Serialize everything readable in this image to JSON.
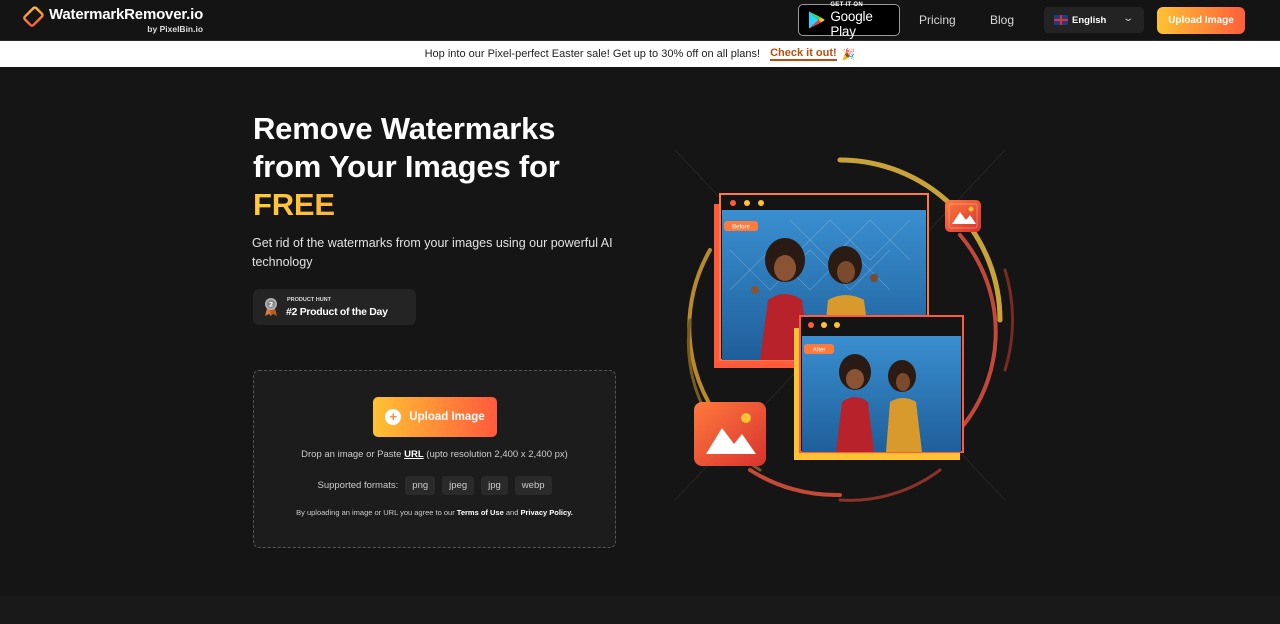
{
  "header": {
    "logo_title": "WatermarkRemover.io",
    "logo_sub": "by PixelBin.io",
    "gplay_small": "GET IT ON",
    "gplay_big": "Google Play",
    "nav": {
      "pricing": "Pricing",
      "blog": "Blog"
    },
    "language": "English",
    "upload_label": "Upload Image"
  },
  "promo": {
    "text": "Hop into our Pixel-perfect Easter sale! Get up to 30% off on all plans!",
    "link": "Check it out!",
    "emoji": "🎉"
  },
  "hero": {
    "title_line1": "Remove Watermarks",
    "title_line2": "from Your Images for",
    "title_highlight": "FREE",
    "description": "Get rid of the watermarks from your images using our powerful AI technology",
    "badge": {
      "small": "PRODUCT HUNT",
      "big": "#2 Product of the Day",
      "medal_number": "2"
    }
  },
  "upload_box": {
    "button_label": "Upload Image",
    "drop_prefix": "Drop an image or Paste",
    "drop_url": "URL",
    "drop_suffix": "(upto resolution 2,400 x 2,400 px)",
    "formats_label": "Supported formats:",
    "formats": [
      "png",
      "jpeg",
      "jpg",
      "webp"
    ],
    "terms_prefix": "By uploading an image or URL you agree to our",
    "terms_link": "Terms of Use",
    "terms_and": "and",
    "privacy_link": "Privacy Policy."
  },
  "illustration": {
    "before_label": "Before",
    "after_label": "After"
  },
  "colors": {
    "accent_start": "#ffc233",
    "accent_end": "#ff5a3c",
    "background": "#151515",
    "promo_link": "#b94e0f"
  }
}
